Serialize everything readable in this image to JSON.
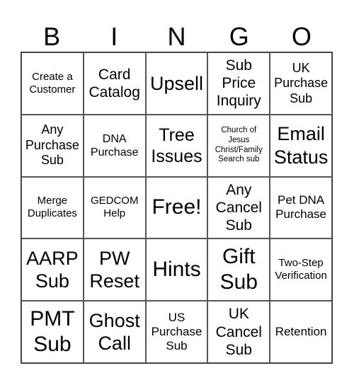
{
  "header": [
    "B",
    "I",
    "N",
    "G",
    "O"
  ],
  "cells": [
    [
      "Create a Customer",
      "Card Catalog",
      "Upsell",
      "Sub Price Inquiry",
      "UK Purchase Sub"
    ],
    [
      "Any Purchase Sub",
      "DNA Purchase",
      "Tree Issues",
      "Church of Jesus Christ/Family Search sub",
      "Email Status"
    ],
    [
      "Merge Duplicates",
      "GEDCOM Help",
      "Free!",
      "Any Cancel Sub",
      "Pet DNA Purchase"
    ],
    [
      "AARP Sub",
      "PW Reset",
      "Hints",
      "Gift Sub",
      "Two-Step Verification"
    ],
    [
      "PMT Sub",
      "Ghost Call",
      "US Purchase Sub",
      "UK Cancel Sub",
      "Retention"
    ]
  ]
}
